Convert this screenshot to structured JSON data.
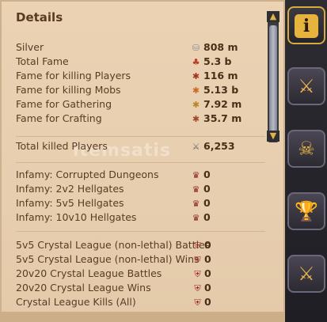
{
  "title": "Details",
  "watermark": "itemsatis",
  "rows": [
    {
      "label": "Silver",
      "value": "808 m",
      "icon": "silver-icon",
      "glyph": "⛁",
      "color": "#8a8f9c"
    },
    {
      "label": "Total Fame",
      "value": "5.3 b",
      "icon": "fame-icon",
      "glyph": "♣",
      "color": "#b8402a"
    },
    {
      "label": "Fame for killing Players",
      "value": "116 m",
      "icon": "pvp-fame-icon",
      "glyph": "✱",
      "color": "#a33424"
    },
    {
      "label": "Fame for killing Mobs",
      "value": "5.13 b",
      "icon": "pve-fame-icon",
      "glyph": "✱",
      "color": "#c86a26"
    },
    {
      "label": "Fame for Gathering",
      "value": "7.92 m",
      "icon": "gathering-fame-icon",
      "glyph": "✱",
      "color": "#b8852a"
    },
    {
      "label": "Fame for Crafting",
      "value": "35.7 m",
      "icon": "crafting-fame-icon",
      "glyph": "✱",
      "color": "#a0462a"
    },
    {
      "label": "Total killed Players",
      "value": "6,253",
      "icon": "crossed-swords-icon",
      "glyph": "⚔",
      "color": "#5d5f66"
    },
    {
      "label": "Infamy: Corrupted Dungeons",
      "value": "0",
      "icon": "infamy-icon",
      "glyph": "♛",
      "color": "#8a1f1f"
    },
    {
      "label": "Infamy: 2v2 Hellgates",
      "value": "0",
      "icon": "infamy-icon",
      "glyph": "♛",
      "color": "#8a1f1f"
    },
    {
      "label": "Infamy: 5v5 Hellgates",
      "value": "0",
      "icon": "infamy-icon",
      "glyph": "♛",
      "color": "#8a1f1f"
    },
    {
      "label": "Infamy: 10v10 Hellgates",
      "value": "0",
      "icon": "infamy-icon",
      "glyph": "♛",
      "color": "#8a1f1f"
    },
    {
      "label": "5v5 Crystal League (non-lethal) Battles",
      "value": "0",
      "icon": "crystal-shield-icon",
      "glyph": "⛨",
      "color": "#9c2a2a"
    },
    {
      "label": "5v5 Crystal League (non-lethal) Wins",
      "value": "0",
      "icon": "crystal-shield-icon",
      "glyph": "⛨",
      "color": "#9c2a2a"
    },
    {
      "label": "20v20 Crystal League Battles",
      "value": "0",
      "icon": "crystal-shield-icon",
      "glyph": "⛨",
      "color": "#9c2a2a"
    },
    {
      "label": "20v20 Crystal League Wins",
      "value": "0",
      "icon": "crystal-shield-icon",
      "glyph": "⛨",
      "color": "#9c2a2a"
    },
    {
      "label": "Crystal League Kills (All)",
      "value": "0",
      "icon": "crystal-shield-icon",
      "glyph": "⛨",
      "color": "#9c2a2a"
    }
  ],
  "tabs": [
    {
      "name": "tab-details",
      "icon": "info-icon",
      "glyph": "i",
      "active": true
    },
    {
      "name": "tab-combat",
      "icon": "crossed-swords-icon",
      "glyph": "⚔",
      "active": false
    },
    {
      "name": "tab-kills",
      "icon": "skull-icon",
      "glyph": "☠",
      "active": false
    },
    {
      "name": "tab-achievements",
      "icon": "trophy-icon",
      "glyph": "🏆",
      "active": false
    },
    {
      "name": "tab-guild-war",
      "icon": "guild-war-icon",
      "glyph": "⚔",
      "active": false
    }
  ]
}
